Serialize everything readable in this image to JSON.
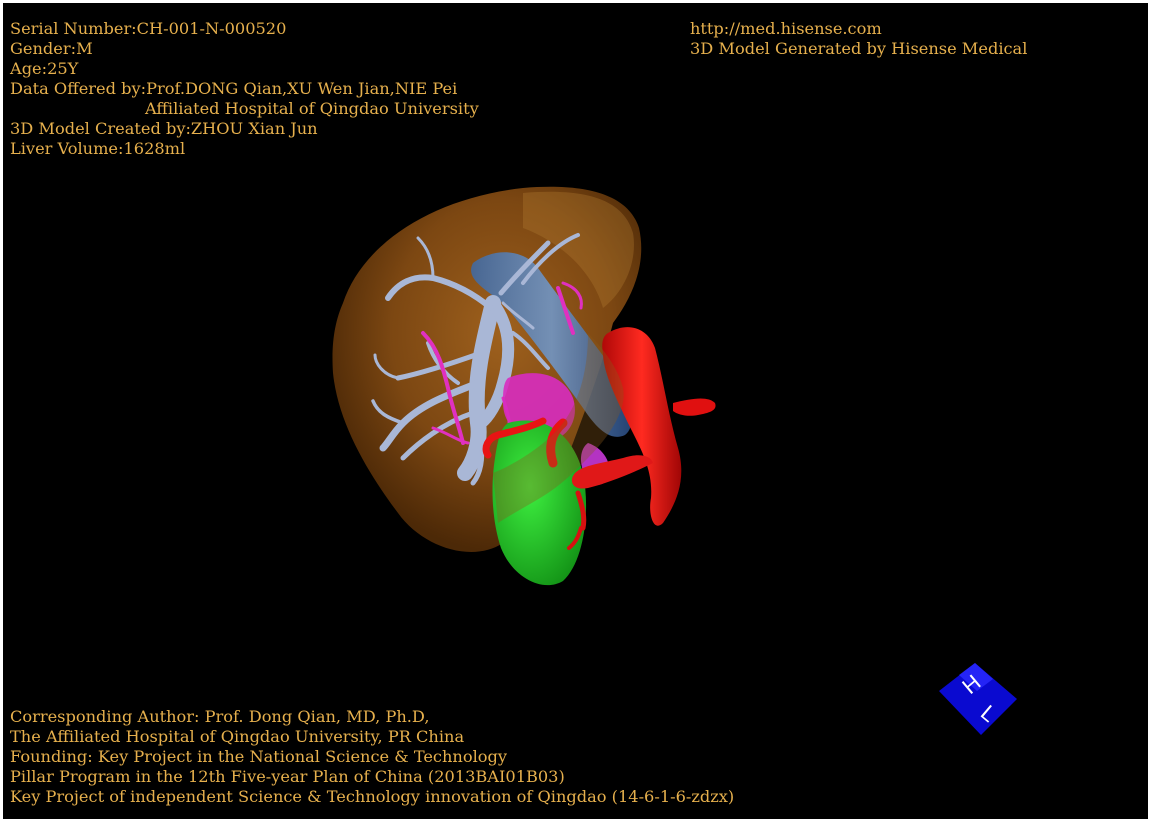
{
  "header_left": {
    "serial": "Serial Number:CH-001-N-000520",
    "gender": "Gender:M",
    "age": "Age:25Y",
    "data_offered": "Data Offered by:Prof.DONG Qian,XU Wen Jian,NIE Pei",
    "affiliation": "Affiliated Hospital of Qingdao University",
    "created_by": "3D Model Created by:ZHOU Xian Jun",
    "liver_volume": "Liver Volume:1628ml"
  },
  "header_right": {
    "url": "http://med.hisense.com",
    "generated_by": "3D Model Generated by Hisense Medical"
  },
  "footer_left": {
    "author": "Corresponding Author: Prof. Dong Qian, MD, Ph.D,",
    "hospital": "The Affiliated Hospital of Qingdao University, PR China",
    "founding": "Founding: Key Project in the National Science & Technology",
    "pillar": "Pillar Program in the 12th Five-year Plan of China (2013BAI01B03)",
    "key_project": "Key Project of independent Science & Technology innovation of Qingdao (14-6-1-6-zdzx)"
  },
  "orientation": {
    "label_h": "H",
    "label_l": "L"
  },
  "colors": {
    "text": "#e6b04d",
    "background": "#000000",
    "liver": "#8a4f14",
    "portal_vein": "#a9b7d6",
    "hepatic_vein": "#4a78b8",
    "artery": "#e01010",
    "biliary": "#e030c0",
    "gallbladder": "#22c025",
    "orientation_cube": "#0a0ad0"
  }
}
